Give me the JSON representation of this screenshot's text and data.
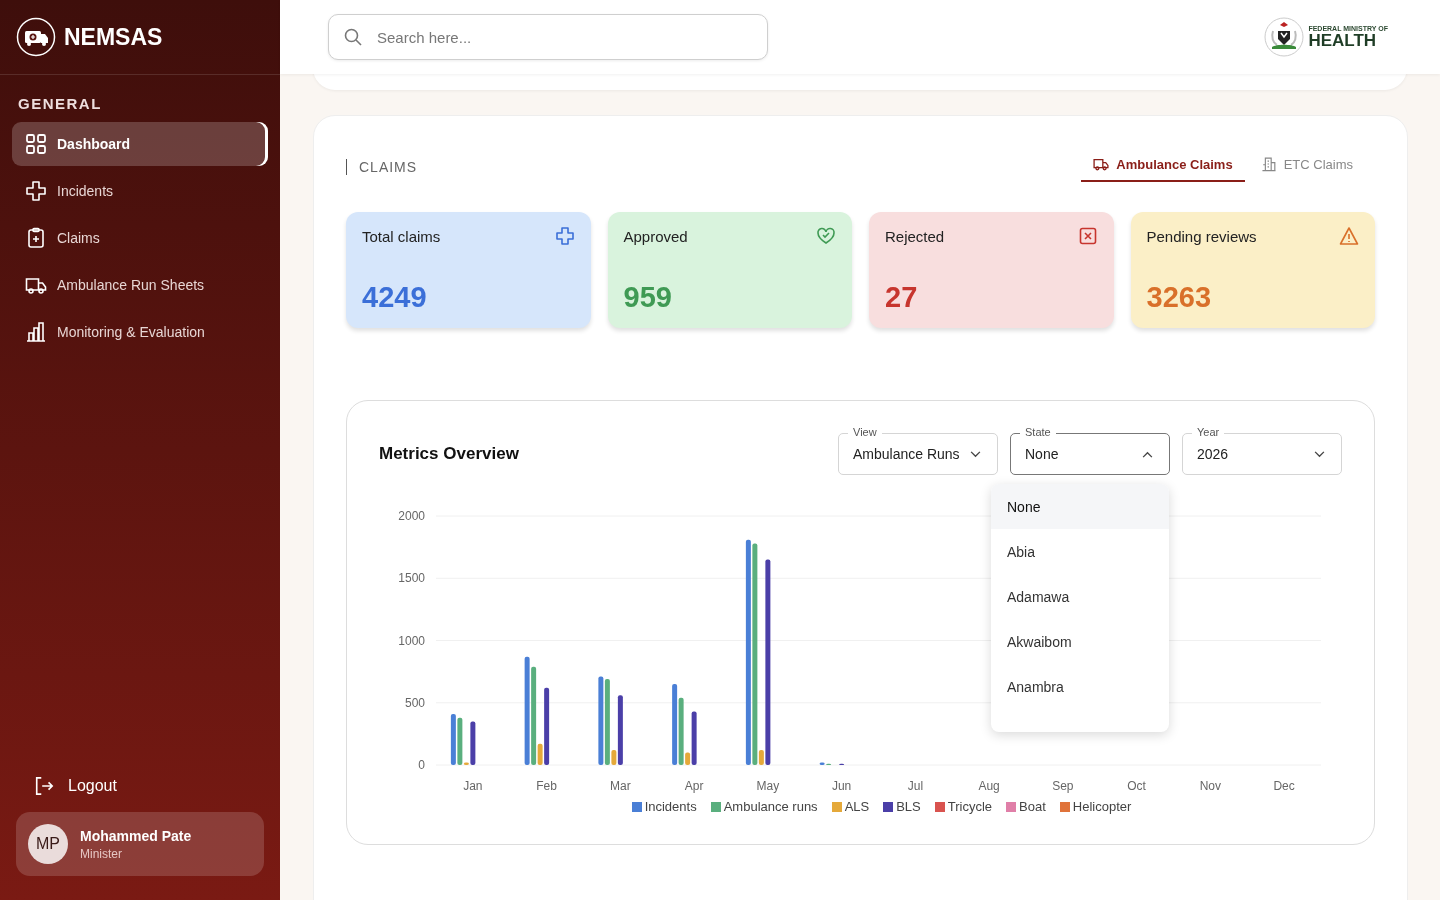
{
  "sidebar": {
    "brand": "NEMSAS",
    "section": "GENERAL",
    "items": [
      {
        "label": "Dashboard",
        "selected": true
      },
      {
        "label": "Incidents",
        "selected": false
      },
      {
        "label": "Claims",
        "selected": false
      },
      {
        "label": "Ambulance Run Sheets",
        "selected": false
      },
      {
        "label": "Monitoring & Evaluation",
        "selected": false
      }
    ],
    "logout": "Logout",
    "user": {
      "initials": "MP",
      "name": "Mohammed Pate",
      "role": "Minister"
    }
  },
  "header": {
    "search": {
      "placeholder": "Search here..."
    },
    "ministry_logo": {
      "small": "FEDERAL MINISTRY OF",
      "large": "HEALTH"
    }
  },
  "claims": {
    "title": "CLAIMS",
    "tabs": [
      {
        "label": "Ambulance Claims",
        "selected": true
      },
      {
        "label": "ETC Claims",
        "selected": false
      }
    ],
    "cards": [
      {
        "kind": "total",
        "label": "Total claims",
        "value": "4249"
      },
      {
        "kind": "approved",
        "label": "Approved",
        "value": "959"
      },
      {
        "kind": "rejected",
        "label": "Rejected",
        "value": "27"
      },
      {
        "kind": "pending",
        "label": "Pending reviews",
        "value": "3263"
      }
    ]
  },
  "metrics": {
    "title": "Metrics Overview",
    "filters": [
      {
        "label": "View",
        "value": "Ambulance Runs",
        "expanded": false
      },
      {
        "label": "State",
        "value": "None",
        "expanded": true
      },
      {
        "label": "Year",
        "value": "2026",
        "expanded": false
      }
    ],
    "state_options": [
      {
        "label": "None",
        "selected": true
      },
      {
        "label": "Abia",
        "selected": false
      },
      {
        "label": "Adamawa",
        "selected": false
      },
      {
        "label": "Akwaibom",
        "selected": false
      },
      {
        "label": "Anambra",
        "selected": false
      }
    ],
    "chart_data": {
      "type": "bar",
      "grid": true,
      "legend": true,
      "categories": [
        "Jan",
        "Feb",
        "Mar",
        "Apr",
        "May",
        "Jun",
        "Jul",
        "Aug",
        "Sep",
        "Oct",
        "Nov",
        "Dec"
      ],
      "ylim": [
        0,
        2000
      ],
      "yticks": [
        0,
        500,
        1000,
        1500,
        2000
      ],
      "series": [
        {
          "name": "Incidents",
          "color": "#4a7fd6",
          "values": [
            410,
            870,
            710,
            650,
            1810,
            20,
            0,
            0,
            0,
            0,
            0,
            0
          ]
        },
        {
          "name": "Ambulance runs",
          "color": "#5aaf7e",
          "values": [
            380,
            790,
            690,
            540,
            1780,
            10,
            0,
            0,
            0,
            0,
            0,
            0
          ]
        },
        {
          "name": "ALS",
          "color": "#e5a93a",
          "values": [
            20,
            170,
            120,
            100,
            120,
            0,
            0,
            0,
            0,
            0,
            0,
            0
          ]
        },
        {
          "name": "BLS",
          "color": "#4b3fa8",
          "values": [
            350,
            620,
            560,
            430,
            1650,
            10,
            0,
            0,
            0,
            0,
            0,
            0
          ]
        },
        {
          "name": "Tricycle",
          "color": "#d9534f",
          "values": [
            0,
            0,
            0,
            0,
            0,
            0,
            0,
            0,
            0,
            0,
            0,
            0
          ]
        },
        {
          "name": "Boat",
          "color": "#e07fa8",
          "values": [
            0,
            0,
            0,
            0,
            0,
            0,
            0,
            0,
            0,
            0,
            0,
            0
          ]
        },
        {
          "name": "Helicopter",
          "color": "#e0733a",
          "values": [
            0,
            0,
            0,
            0,
            0,
            0,
            0,
            0,
            0,
            0,
            0,
            0
          ]
        }
      ]
    }
  }
}
